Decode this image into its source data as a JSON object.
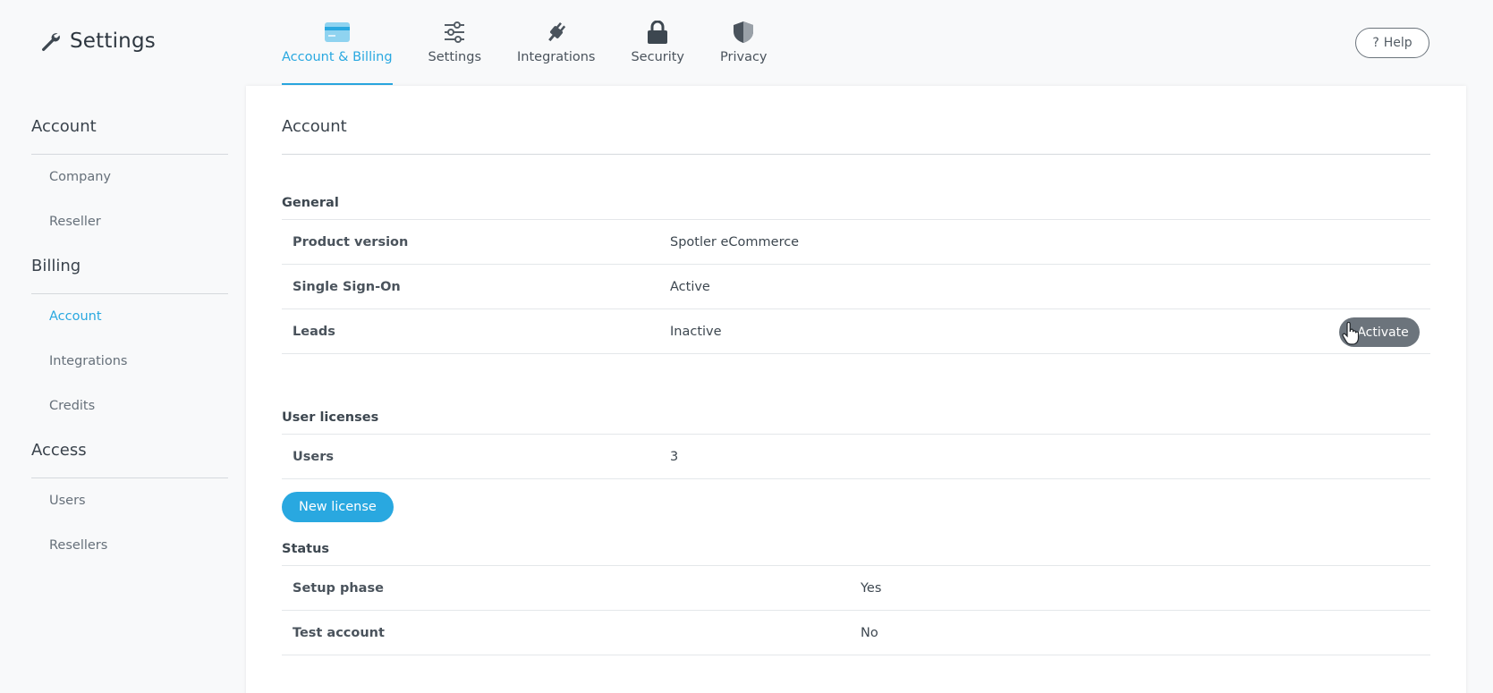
{
  "app": {
    "title": "Settings"
  },
  "nav": {
    "tabs": [
      {
        "label": "Account & Billing",
        "icon": "credit-card-icon",
        "active": true
      },
      {
        "label": "Settings",
        "icon": "sliders-icon",
        "active": false
      },
      {
        "label": "Integrations",
        "icon": "plug-icon",
        "active": false
      },
      {
        "label": "Security",
        "icon": "lock-icon",
        "active": false
      },
      {
        "label": "Privacy",
        "icon": "shield-icon",
        "active": false
      }
    ],
    "help_label": "Help",
    "help_glyph": "?"
  },
  "sidebar": {
    "sections": [
      {
        "heading": "Account",
        "items": [
          {
            "label": "Company"
          },
          {
            "label": "Reseller"
          }
        ]
      },
      {
        "heading": "Billing",
        "items": [
          {
            "label": "Account",
            "active": true
          },
          {
            "label": "Integrations"
          },
          {
            "label": "Credits"
          }
        ]
      },
      {
        "heading": "Access",
        "items": [
          {
            "label": "Users"
          },
          {
            "label": "Resellers"
          }
        ]
      }
    ]
  },
  "main": {
    "title": "Account",
    "general": {
      "heading": "General",
      "rows": [
        {
          "key": "Product version",
          "value": "Spotler eCommerce"
        },
        {
          "key": "Single Sign-On",
          "value": "Active"
        },
        {
          "key": "Leads",
          "value": "Inactive",
          "action": "Activate"
        }
      ]
    },
    "licenses": {
      "heading": "User licenses",
      "rows": [
        {
          "key": "Users",
          "value": "3"
        }
      ],
      "new_license_label": "New license"
    },
    "status": {
      "heading": "Status",
      "rows": [
        {
          "key": "Setup phase",
          "value": "Yes"
        },
        {
          "key": "Test account",
          "value": "No"
        }
      ]
    }
  },
  "colors": {
    "accent": "#29a8e0",
    "activate_button": "#6c747c",
    "text": "#3d4750"
  }
}
